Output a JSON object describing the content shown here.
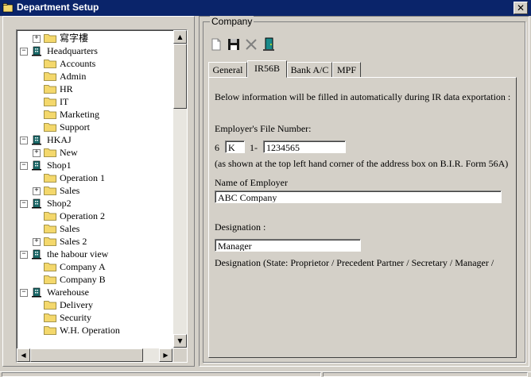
{
  "window": {
    "title": "Department Setup",
    "close_glyph": "✕"
  },
  "tree": {
    "items": [
      {
        "label": "寫字樓",
        "level": 1,
        "expander": "+",
        "icon": "folder-icon"
      },
      {
        "label": "Headquarters",
        "level": 0,
        "expander": "−",
        "icon": "building-icon"
      },
      {
        "label": "Accounts",
        "level": 1,
        "expander": "",
        "icon": "folder-icon"
      },
      {
        "label": "Admin",
        "level": 1,
        "expander": "",
        "icon": "folder-icon"
      },
      {
        "label": "HR",
        "level": 1,
        "expander": "",
        "icon": "folder-icon"
      },
      {
        "label": "IT",
        "level": 1,
        "expander": "",
        "icon": "folder-icon"
      },
      {
        "label": "Marketing",
        "level": 1,
        "expander": "",
        "icon": "folder-icon"
      },
      {
        "label": "Support",
        "level": 1,
        "expander": "",
        "icon": "folder-icon"
      },
      {
        "label": "HKAJ",
        "level": 0,
        "expander": "−",
        "icon": "building-icon"
      },
      {
        "label": "New",
        "level": 1,
        "expander": "+",
        "icon": "folder-icon"
      },
      {
        "label": "Shop1",
        "level": 0,
        "expander": "−",
        "icon": "building-icon"
      },
      {
        "label": "Operation 1",
        "level": 1,
        "expander": "",
        "icon": "folder-icon"
      },
      {
        "label": "Sales",
        "level": 1,
        "expander": "+",
        "icon": "folder-icon"
      },
      {
        "label": "Shop2",
        "level": 0,
        "expander": "−",
        "icon": "building-icon"
      },
      {
        "label": "Operation 2",
        "level": 1,
        "expander": "",
        "icon": "folder-icon"
      },
      {
        "label": "Sales",
        "level": 1,
        "expander": "",
        "icon": "folder-icon"
      },
      {
        "label": "Sales 2",
        "level": 1,
        "expander": "+",
        "icon": "folder-icon"
      },
      {
        "label": "the habour view",
        "level": 0,
        "expander": "−",
        "icon": "building-icon"
      },
      {
        "label": "Company A",
        "level": 1,
        "expander": "",
        "icon": "folder-icon"
      },
      {
        "label": "Company B",
        "level": 1,
        "expander": "",
        "icon": "folder-icon"
      },
      {
        "label": "Warehouse",
        "level": 0,
        "expander": "−",
        "icon": "building-icon"
      },
      {
        "label": "Delivery",
        "level": 1,
        "expander": "",
        "icon": "folder-icon"
      },
      {
        "label": "Security",
        "level": 1,
        "expander": "",
        "icon": "folder-icon"
      },
      {
        "label": "W.H. Operation",
        "level": 1,
        "expander": "",
        "icon": "folder-icon"
      }
    ],
    "scroll_up": "▲",
    "scroll_down": "▼",
    "scroll_left": "◀",
    "scroll_right": "▶"
  },
  "company": {
    "group_label": "Company",
    "toolbar": [
      "new-document-icon",
      "save-icon",
      "delete-icon",
      "exit-door-icon"
    ],
    "tabs": [
      {
        "label": "General",
        "active": false
      },
      {
        "label": "IR56B",
        "active": true
      },
      {
        "label": "Bank A/C",
        "active": false
      },
      {
        "label": "MPF",
        "active": false
      }
    ],
    "ir56b": {
      "intro": "Below information will be filled in automatically during IR data exportation :",
      "file_number_label": "Employer's File Number:",
      "file_prefix": "6",
      "file_code": "K",
      "file_sep": "1-",
      "file_number": "1234565",
      "file_note": "(as shown at the top left hand corner of the address box on B.I.R. Form 56A)",
      "employer_name_label": "Name of Employer",
      "employer_name": "ABC Company",
      "designation_label": "Designation :",
      "designation": "Manager",
      "designation_note": "Designation (State: Proprietor / Precedent Partner / Secretary / Manager /"
    }
  },
  "colors": {
    "title_bar": "#0a246a",
    "face": "#d4d0c8",
    "folder": "#f4d86c"
  }
}
